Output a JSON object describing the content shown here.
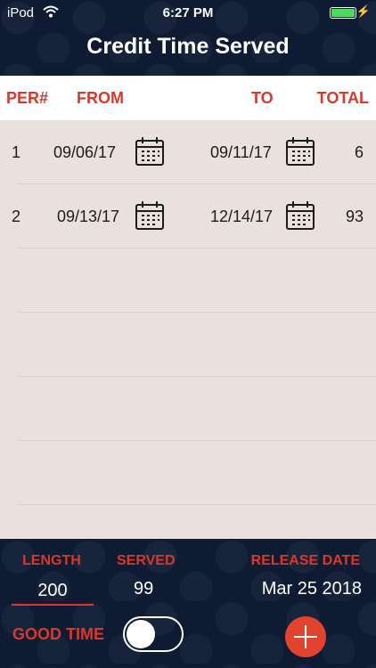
{
  "status": {
    "carrier": "iPod",
    "time": "6:27 PM"
  },
  "header": {
    "title": "Credit Time Served"
  },
  "columns": {
    "per": "PER#",
    "from": "FROM",
    "to": "TO",
    "total": "TOTAL"
  },
  "rows": [
    {
      "per": "1",
      "from": "09/06/17",
      "to": "09/11/17",
      "total": "6"
    },
    {
      "per": "2",
      "from": "09/13/17",
      "to": "12/14/17",
      "total": "93"
    }
  ],
  "footer": {
    "length_label": "LENGTH",
    "length_value": "200",
    "served_label": "SERVED",
    "served_value": "99",
    "release_label": "RELEASE DATE",
    "release_value": "Mar 25 2018",
    "good_time_label": "GOOD TIME",
    "good_time_on": false
  },
  "colors": {
    "accent": "#d9382a",
    "navy": "#0f1b33",
    "table_bg": "#ebe1dc",
    "add_button": "#e2432f"
  },
  "icons": {
    "calendar": "calendar-icon",
    "add": "plus-icon",
    "wifi": "wifi-icon",
    "battery": "battery-icon"
  }
}
